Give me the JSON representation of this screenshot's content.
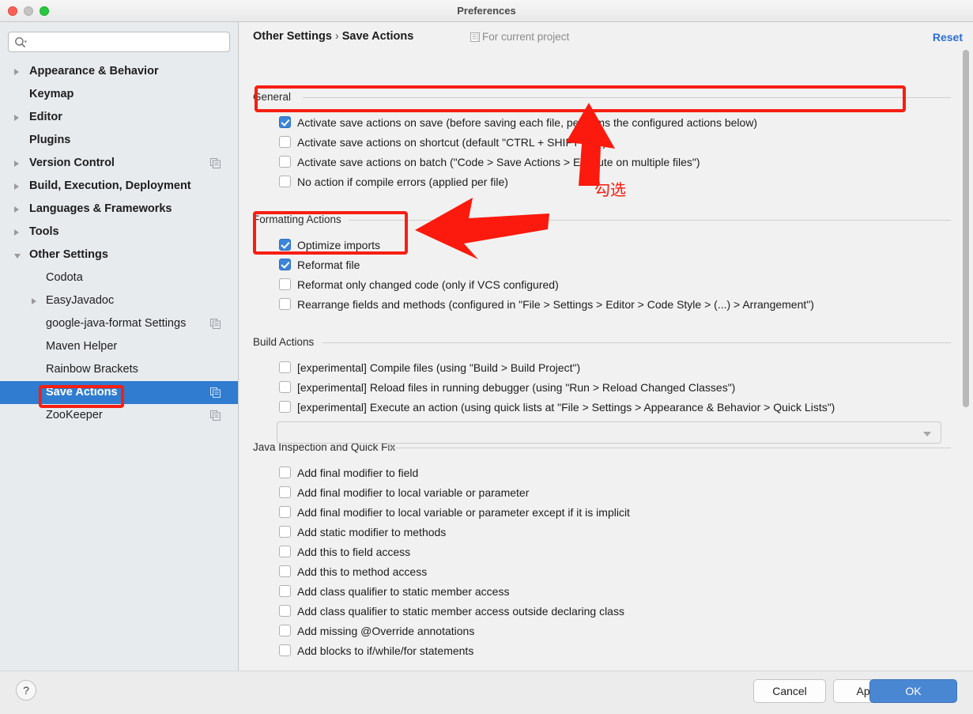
{
  "window": {
    "title": "Preferences",
    "controls": [
      "close-button",
      "minimize-button",
      "maximize-button"
    ]
  },
  "sidebar": {
    "search": {
      "value": "",
      "placeholder": ""
    },
    "items": [
      {
        "label": "Appearance & Behavior",
        "level": 0,
        "twisty": "closed",
        "copy_icon": false,
        "selected": false
      },
      {
        "label": "Keymap",
        "level": 0,
        "twisty": "none",
        "copy_icon": false,
        "selected": false
      },
      {
        "label": "Editor",
        "level": 0,
        "twisty": "closed",
        "copy_icon": false,
        "selected": false
      },
      {
        "label": "Plugins",
        "level": 0,
        "twisty": "none",
        "copy_icon": false,
        "selected": false
      },
      {
        "label": "Version Control",
        "level": 0,
        "twisty": "closed",
        "copy_icon": true,
        "selected": false
      },
      {
        "label": "Build, Execution, Deployment",
        "level": 0,
        "twisty": "closed",
        "copy_icon": false,
        "selected": false
      },
      {
        "label": "Languages & Frameworks",
        "level": 0,
        "twisty": "closed",
        "copy_icon": false,
        "selected": false
      },
      {
        "label": "Tools",
        "level": 0,
        "twisty": "closed",
        "copy_icon": false,
        "selected": false
      },
      {
        "label": "Other Settings",
        "level": 0,
        "twisty": "open",
        "copy_icon": false,
        "selected": false
      },
      {
        "label": "Codota",
        "level": 1,
        "twisty": "none",
        "copy_icon": false,
        "selected": false
      },
      {
        "label": "EasyJavadoc",
        "level": 1,
        "twisty": "closed",
        "copy_icon": false,
        "selected": false
      },
      {
        "label": "google-java-format Settings",
        "level": 1,
        "twisty": "none",
        "copy_icon": true,
        "selected": false
      },
      {
        "label": "Maven Helper",
        "level": 1,
        "twisty": "none",
        "copy_icon": false,
        "selected": false
      },
      {
        "label": "Rainbow Brackets",
        "level": 1,
        "twisty": "none",
        "copy_icon": false,
        "selected": false
      },
      {
        "label": "Save Actions",
        "level": 1,
        "twisty": "none",
        "copy_icon": true,
        "selected": true
      },
      {
        "label": "ZooKeeper",
        "level": 1,
        "twisty": "none",
        "copy_icon": true,
        "selected": false
      }
    ]
  },
  "header": {
    "breadcrumb_parent": "Other Settings",
    "breadcrumb_separator": "›",
    "breadcrumb_current": "Save Actions",
    "project_scope_label": "For current project",
    "reset_label": "Reset"
  },
  "sections": [
    {
      "title": "General",
      "items": [
        {
          "label": "Activate save actions on save (before saving each file, performs the configured actions below)",
          "checked": true
        },
        {
          "label": "Activate save actions on shortcut (default \"CTRL + SHIFT + S\")",
          "checked": false
        },
        {
          "label": "Activate save actions on batch (\"Code > Save Actions > Execute on multiple files\")",
          "checked": false
        },
        {
          "label": "No action if compile errors (applied per file)",
          "checked": false
        }
      ]
    },
    {
      "title": "Formatting Actions",
      "items": [
        {
          "label": "Optimize imports",
          "checked": true
        },
        {
          "label": "Reformat file",
          "checked": true
        },
        {
          "label": "Reformat only changed code (only if VCS configured)",
          "checked": false
        },
        {
          "label": "Rearrange fields and methods (configured in \"File > Settings > Editor > Code Style > (...) > Arrangement\")",
          "checked": false
        }
      ]
    },
    {
      "title": "Build Actions",
      "items": [
        {
          "label": "[experimental] Compile files (using \"Build > Build Project\")",
          "checked": false
        },
        {
          "label": "[experimental] Reload files in running debugger (using \"Run > Reload Changed Classes\")",
          "checked": false
        },
        {
          "label": "[experimental] Execute an action (using quick lists at \"File > Settings > Appearance & Behavior > Quick Lists\")",
          "checked": false
        }
      ]
    },
    {
      "title": "Java Inspection and Quick Fix",
      "items": [
        {
          "label": "Add final modifier to field",
          "checked": false
        },
        {
          "label": "Add final modifier to local variable or parameter",
          "checked": false
        },
        {
          "label": "Add final modifier to local variable or parameter except if it is implicit",
          "checked": false
        },
        {
          "label": "Add static modifier to methods",
          "checked": false
        },
        {
          "label": "Add this to field access",
          "checked": false
        },
        {
          "label": "Add this to method access",
          "checked": false
        },
        {
          "label": "Add class qualifier to static member access",
          "checked": false
        },
        {
          "label": "Add class qualifier to static member access outside declaring class",
          "checked": false
        },
        {
          "label": "Add missing @Override annotations",
          "checked": false
        },
        {
          "label": "Add blocks to if/while/for statements",
          "checked": false
        }
      ]
    }
  ],
  "quick_list_combo": {
    "value": "",
    "enabled": false
  },
  "footer": {
    "help_label": "?",
    "cancel_label": "Cancel",
    "apply_label": "Apply",
    "ok_label": "OK"
  },
  "annotations": {
    "note_text": "勾选",
    "color": "#f61f12"
  }
}
